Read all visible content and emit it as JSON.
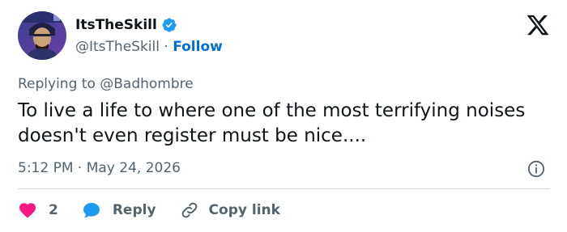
{
  "author": {
    "display_name": "ItsTheSkill",
    "handle": "@ItsTheSkill",
    "follow_label": "Follow",
    "separator": "·",
    "verified": true
  },
  "reply_to": {
    "prefix": "Replying to",
    "handle": "@Badhombre"
  },
  "tweet": {
    "text": "To live a life to where one of the most terrifying noises doesn't even register must be nice...."
  },
  "timestamp": "5:12 PM · May 24, 2026",
  "actions": {
    "likes": "2",
    "reply_label": "Reply",
    "copy_link_label": "Copy link"
  },
  "colors": {
    "accent": "#006fd6",
    "verified": "#1d9bf0",
    "heart": "#f91880",
    "reply_bubble": "#1d9bf0",
    "muted_text": "#536471"
  },
  "icons": [
    "avatar",
    "verified-badge-icon",
    "x-logo-icon",
    "info-icon",
    "heart-icon",
    "reply-bubble-icon",
    "link-icon"
  ]
}
